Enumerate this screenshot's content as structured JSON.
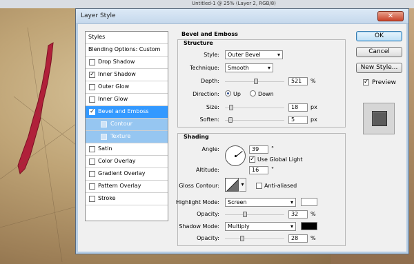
{
  "background": {
    "doc_title": "Untitled-1 @ 25% (Layer 2, RGB/8)"
  },
  "dialog": {
    "title": "Layer Style",
    "close_glyph": "✕"
  },
  "styles_list": {
    "header": "Styles",
    "blending_options": "Blending Options: Custom",
    "items": [
      {
        "label": "Drop Shadow",
        "checked": false
      },
      {
        "label": "Inner Shadow",
        "checked": true
      },
      {
        "label": "Outer Glow",
        "checked": false
      },
      {
        "label": "Inner Glow",
        "checked": false
      },
      {
        "label": "Bevel and Emboss",
        "checked": true
      },
      {
        "label": "Contour",
        "checked": false
      },
      {
        "label": "Texture",
        "checked": false
      },
      {
        "label": "Satin",
        "checked": false
      },
      {
        "label": "Color Overlay",
        "checked": false
      },
      {
        "label": "Gradient Overlay",
        "checked": false
      },
      {
        "label": "Pattern Overlay",
        "checked": false
      },
      {
        "label": "Stroke",
        "checked": false
      }
    ]
  },
  "bevel": {
    "section_title": "Bevel and Emboss",
    "structure": {
      "title": "Structure",
      "style_label": "Style:",
      "style_value": "Outer Bevel",
      "technique_label": "Technique:",
      "technique_value": "Smooth",
      "depth_label": "Depth:",
      "depth_value": "521",
      "depth_unit": "%",
      "depth_level": 0.52,
      "direction_label": "Direction:",
      "direction_up": "Up",
      "direction_down": "Down",
      "size_label": "Size:",
      "size_value": "18",
      "size_unit": "px",
      "size_level": 0.07,
      "soften_label": "Soften:",
      "soften_value": "5",
      "soften_unit": "px",
      "soften_level": 0.06
    },
    "shading": {
      "title": "Shading",
      "angle_label": "Angle:",
      "angle_value": "39",
      "angle_unit": "°",
      "global_light_label": "Use Global Light",
      "altitude_label": "Altitude:",
      "altitude_value": "16",
      "altitude_unit": "°",
      "gloss_contour_label": "Gloss Contour:",
      "anti_aliased_label": "Anti-aliased",
      "highlight_mode_label": "Highlight Mode:",
      "highlight_mode_value": "Screen",
      "highlight_color": "#ffffff",
      "highlight_opacity_label": "Opacity:",
      "highlight_opacity_value": "32",
      "highlight_opacity_unit": "%",
      "highlight_opacity_level": 0.32,
      "shadow_mode_label": "Shadow Mode:",
      "shadow_mode_value": "Multiply",
      "shadow_color": "#000000",
      "shadow_opacity_label": "Opacity:",
      "shadow_opacity_value": "28",
      "shadow_opacity_unit": "%",
      "shadow_opacity_level": 0.28
    }
  },
  "buttons": {
    "ok": "OK",
    "cancel": "Cancel",
    "new_style": "New Style...",
    "preview_label": "Preview"
  },
  "colors": {
    "selection": "#3399ff",
    "sub_selection": "#96c6f1",
    "blood": "#b0203a"
  }
}
